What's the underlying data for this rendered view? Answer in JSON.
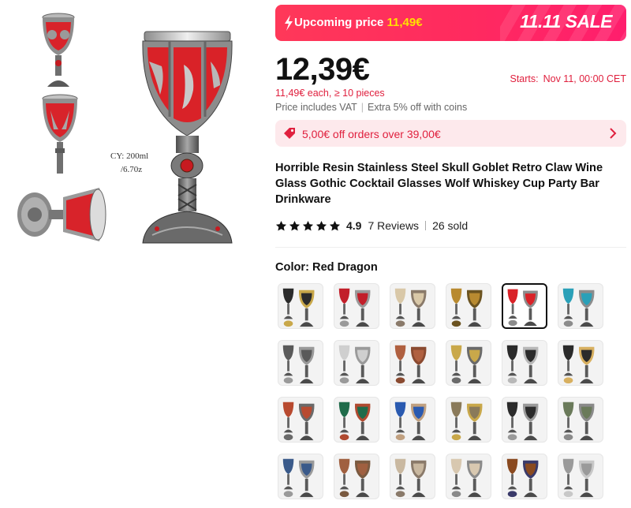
{
  "gallery": {
    "capacity_line1": "CY: 200ml",
    "capacity_line2": "/6.70z"
  },
  "sale": {
    "upcoming_label": "Upcoming price",
    "upcoming_price": "11,49€",
    "event_title": "11.11 SALE"
  },
  "pricing": {
    "current_price": "12,39€",
    "starts_label": "Starts:",
    "starts_value": "Nov 11, 00:00 CET",
    "bulk_price": "11,49€ each, ≥ 10 pieces",
    "vat_text": "Price includes VAT",
    "coins_text": "Extra 5% off with coins"
  },
  "coupon": {
    "text": "5,00€ off orders over 39,00€"
  },
  "product": {
    "title": "Horrible Resin Stainless Steel Skull Goblet Retro Claw Wine Glass Gothic Cocktail Glasses Wolf Whiskey Cup Party Bar Drinkware",
    "rating": "4.9",
    "reviews": "7 Reviews",
    "sold": "26 sold"
  },
  "variants": {
    "label": "Color:",
    "selected": "Red Dragon",
    "selected_index": 4,
    "count": 24
  },
  "icons": {
    "bolt": "lightning-icon",
    "coupon": "tag-icon",
    "chevron": "chevron-right-icon",
    "star": "star-icon"
  },
  "colors": {
    "sale_red": "#ff2a5f",
    "price_red": "#e0203e",
    "highlight_yellow": "#ffe100",
    "coupon_bg": "#fde9ec"
  }
}
